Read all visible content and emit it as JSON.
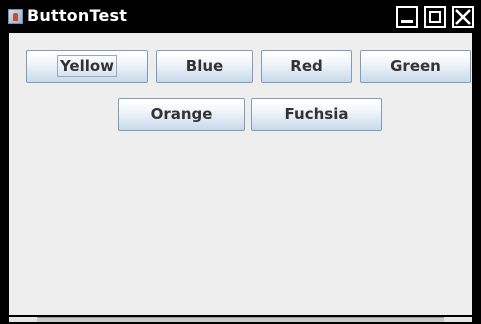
{
  "window": {
    "title": "ButtonTest",
    "app_icon": "java-cup-icon",
    "controls": {
      "minimize_icon": "minimize-icon",
      "maximize_icon": "maximize-icon",
      "close_icon": "close-icon"
    }
  },
  "buttons": [
    {
      "label": "Yellow",
      "focused": true
    },
    {
      "label": "Blue",
      "focused": false
    },
    {
      "label": "Red",
      "focused": false
    },
    {
      "label": "Green",
      "focused": false
    },
    {
      "label": "Orange",
      "focused": false
    },
    {
      "label": "Fuchsia",
      "focused": false
    }
  ],
  "colors": {
    "titlebar_bg": "#000000",
    "titlebar_text": "#ffffff",
    "content_bg": "#eeeeee",
    "button_border": "#7f9db9",
    "button_text": "#333333"
  }
}
